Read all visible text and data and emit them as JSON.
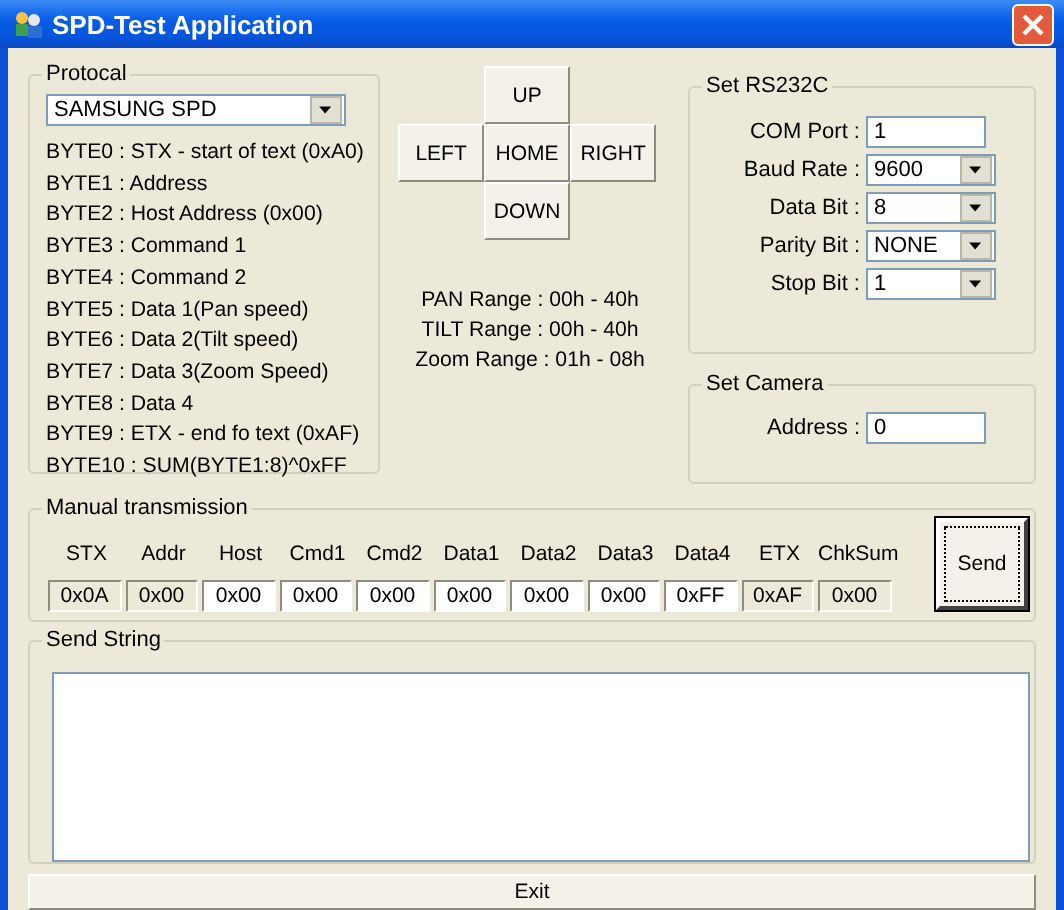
{
  "window": {
    "title": "SPD-Test Application"
  },
  "protocol": {
    "label": "Protocal",
    "selected_value": "SAMSUNG SPD",
    "bytes": [
      "BYTE0 : STX - start of text (0xA0)",
      "BYTE1 : Address",
      "BYTE2 : Host Address (0x00)",
      "BYTE3 : Command 1",
      "BYTE4 : Command 2",
      "BYTE5 : Data 1(Pan speed)",
      "BYTE6 : Data 2(Tilt speed)",
      "BYTE7 : Data 3(Zoom Speed)",
      "BYTE8 : Data 4",
      "BYTE9 : ETX - end fo text (0xAF)",
      "BYTE10 : SUM(BYTE1:8)^0xFF"
    ]
  },
  "direction_buttons": [
    "UP",
    "LEFT",
    "HOME",
    "RIGHT",
    "DOWN"
  ],
  "ranges": [
    "PAN Range : 00h - 40h",
    "TILT Range : 00h - 40h",
    "Zoom Range : 01h - 08h"
  ],
  "rs232c": {
    "label": "Set RS232C",
    "fields": [
      {
        "label": "COM Port :",
        "value": "1",
        "kind": "text"
      },
      {
        "label": "Baud Rate :",
        "value": "9600",
        "kind": "combo"
      },
      {
        "label": "Data Bit :",
        "value": "8",
        "kind": "combo"
      },
      {
        "label": "Parity Bit :",
        "value": "NONE",
        "kind": "combo"
      },
      {
        "label": "Stop Bit :",
        "value": "1",
        "kind": "combo"
      }
    ]
  },
  "camera": {
    "label": "Set Camera",
    "fields": [
      {
        "label": "Address :",
        "value": "0",
        "kind": "text"
      }
    ]
  },
  "manual": {
    "label": "Manual transmission",
    "columns": [
      {
        "name": "STX",
        "value": "0x0A",
        "disabled": true
      },
      {
        "name": "Addr",
        "value": "0x00",
        "disabled": true
      },
      {
        "name": "Host",
        "value": "0x00",
        "disabled": false
      },
      {
        "name": "Cmd1",
        "value": "0x00",
        "disabled": false
      },
      {
        "name": "Cmd2",
        "value": "0x00",
        "disabled": false
      },
      {
        "name": "Data1",
        "value": "0x00",
        "disabled": false
      },
      {
        "name": "Data2",
        "value": "0x00",
        "disabled": false
      },
      {
        "name": "Data3",
        "value": "0x00",
        "disabled": false
      },
      {
        "name": "Data4",
        "value": "0xFF",
        "disabled": false
      },
      {
        "name": "ETX",
        "value": "0xAF",
        "disabled": true
      },
      {
        "name": "ChkSum",
        "value": "0x00",
        "disabled": true
      }
    ],
    "send_button": "Send"
  },
  "send_string": {
    "label": "Send String"
  },
  "exit_button": "Exit"
}
